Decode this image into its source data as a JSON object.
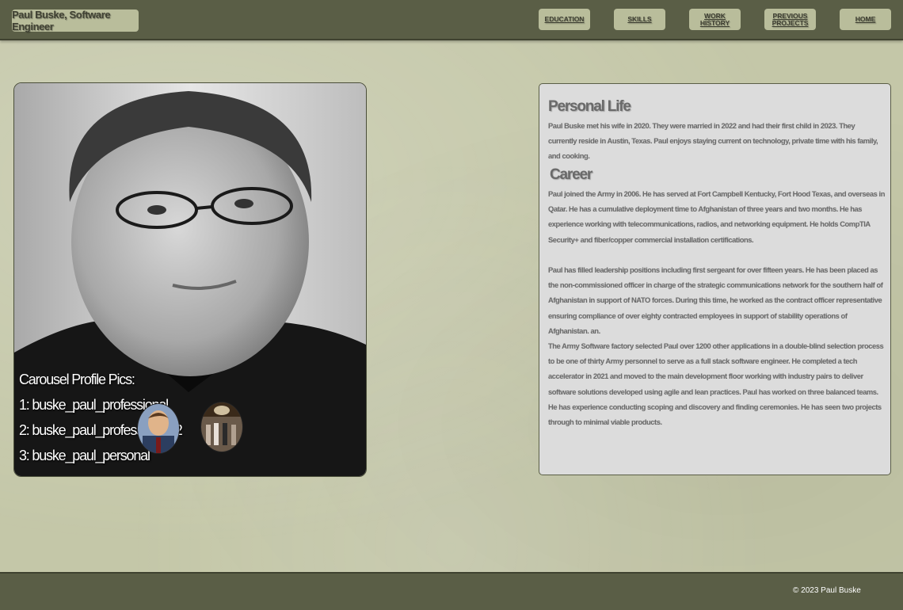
{
  "header": {
    "brand": "Paul Buske, Software Engineer",
    "nav": [
      {
        "label": "EDUCATION"
      },
      {
        "label": "SKILLS"
      },
      {
        "label": "WORK HISTORY"
      },
      {
        "label": "PREVIOUS PROJECTS"
      },
      {
        "label": "HOME"
      }
    ]
  },
  "carousel": {
    "title": "Carousel Profile Pics:",
    "items": [
      "1: buske_paul_professional",
      "2: buske_paul_professional02",
      "3: buske_paul_personal"
    ]
  },
  "about": {
    "personal_heading": "Personal Life",
    "personal_text": "Paul Buske met his wife in 2020. They were married in 2022 and had their first child in 2023. They currently reside in Austin, Texas. Paul enjoys staying current on technology, private time with his family, and cooking.",
    "career_heading": "Career",
    "career_p1": "Paul joined the Army in 2006. He has served at Fort Campbell Kentucky, Fort Hood Texas, and overseas in Qatar. He has a cumulative deployment time to Afghanistan of three years and two months. He has experience working with telecommunications, radios, and networking equipment. He holds CompTIA Security+ and fiber/copper commercial installation certifications.",
    "career_p2": "Paul has filled leadership positions including first sergeant for over fifteen years. He has been placed as the  non-commissioned officer in charge of the strategic communications network for the southern half of Afghanistan in support of NATO forces. During this time, he worked as the contract officer representative ensuring compliance of over eighty contracted employees in support of stability operations of Afghanistan. an.",
    "career_p3": "The Army Software factory selected Paul over 1200 other applications in a double-blind selection process to be one of thirty Army personnel to serve as a full stack software engineer. He completed a tech accelerator in 2021 and moved to the main development floor working with industry pairs to deliver software solutions developed using agile and lean practices. Paul has worked on three balanced teams. He has experience conducting scoping and discovery and finding ceremonies. He has seen two projects through to minimal viable products."
  },
  "footer": {
    "copyright": "© 2023  Paul Buske"
  },
  "colors": {
    "page_bg": "#c4c7a8",
    "bar_bg": "#5a5e46",
    "button_bg": "#b9bd9b",
    "panel_bg": "#dcdcdc"
  }
}
